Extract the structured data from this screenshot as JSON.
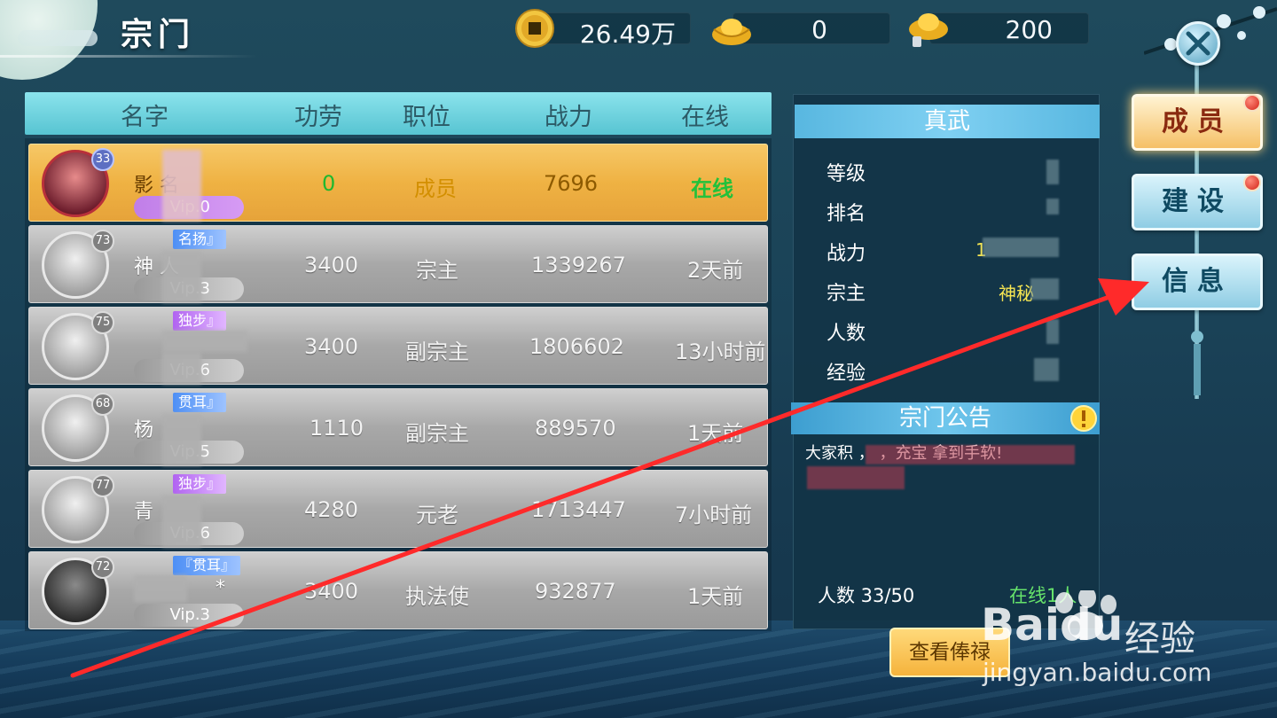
{
  "header": {
    "title": "宗门",
    "currencies": [
      {
        "icon": "copper-coin-icon",
        "value": "26.49万"
      },
      {
        "icon": "gold-ingot-icon",
        "value": "0"
      },
      {
        "icon": "silver-ingot-icon",
        "value": "200"
      }
    ]
  },
  "members_table": {
    "columns": [
      "名字",
      "功劳",
      "职位",
      "战力",
      "在线"
    ],
    "rows": [
      {
        "level": "33",
        "title_tag": "",
        "name": "影  名",
        "vip": "Vip.0",
        "merit": "0",
        "position": "成员",
        "power": "7696",
        "online": "在线",
        "highlight": true
      },
      {
        "level": "73",
        "title_tag": "名扬』",
        "name": "神  人",
        "vip": "Vip.3",
        "merit": "3400",
        "position": "宗主",
        "power": "1339267",
        "online": "2天前",
        "highlight": false
      },
      {
        "level": "75",
        "title_tag": "独步』",
        "name": "",
        "vip": "Vip.6",
        "merit": "3400",
        "position": "副宗主",
        "power": "1806602",
        "online": "13小时前",
        "highlight": false
      },
      {
        "level": "68",
        "title_tag": "贯耳』",
        "name": "杨",
        "vip": "Vip.5",
        "merit": "1110",
        "position": "副宗主",
        "power": "889570",
        "online": "1天前",
        "highlight": false
      },
      {
        "level": "77",
        "title_tag": "独步』",
        "name": "青",
        "vip": "Vip.6",
        "merit": "4280",
        "position": "元老",
        "power": "1713447",
        "online": "7小时前",
        "highlight": false
      },
      {
        "level": "72",
        "title_tag": "『贯耳』",
        "name": "  *",
        "vip": "Vip.3",
        "merit": "3400",
        "position": "执法使",
        "power": "932877",
        "online": "1天前",
        "highlight": false
      }
    ]
  },
  "sect_info": {
    "name": "真武",
    "labels": [
      "等级",
      "排名",
      "战力",
      "宗主",
      "人数",
      "经验"
    ],
    "values": [
      "",
      "",
      "1",
      "神秘",
      "",
      "4540/150"
    ],
    "notice_title": "宗门公告",
    "notice_text": "大家积  ，  ，充宝 拿到手软!",
    "member_count": "人数  33/50",
    "online_count": "在线1人",
    "salary_button": "查看俸禄"
  },
  "nav": {
    "members": "成员",
    "build": "建设",
    "info": "信息"
  },
  "watermark": {
    "brand": "Bai",
    "brand2": "du",
    "suffix": "经验",
    "url": "jingyan.baidu.com"
  },
  "colors": {
    "table_header": "#57c4d2",
    "highlight_row": "#efb243",
    "online_green": "#22c13b",
    "position_gold": "#d38f00",
    "arrow_red": "#ff2a2a"
  }
}
